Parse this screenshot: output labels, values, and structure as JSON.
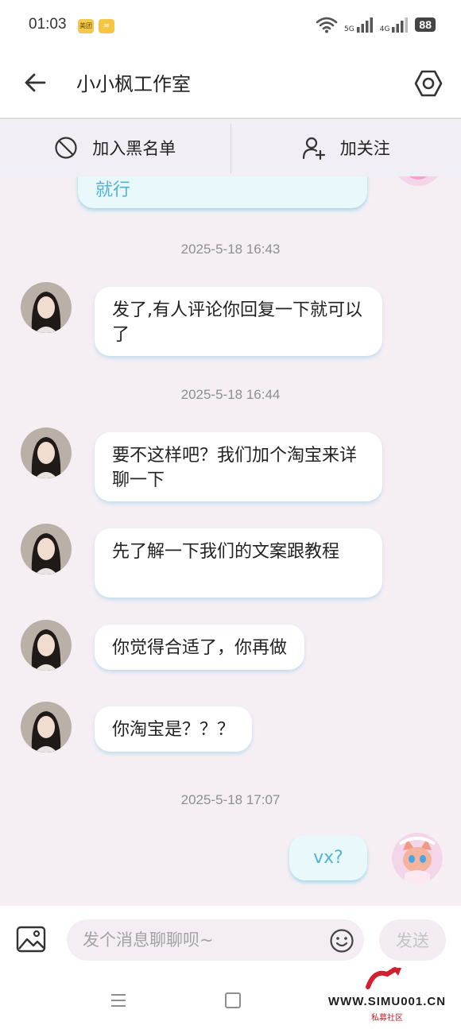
{
  "status_bar": {
    "time": "01:03",
    "app_badges": [
      "美团",
      "✉"
    ],
    "net_5g": "5G",
    "net_4g": "4G",
    "battery": "88"
  },
  "header": {
    "title": "小小枫工作室"
  },
  "actions": {
    "block_label": "加入黑名单",
    "follow_label": "加关注"
  },
  "messages": {
    "partial_mine": "就行",
    "t1": "2025-5-18 16:43",
    "m1": "发了,有人评论你回复一下就可以了",
    "t2": "2025-5-18 16:44",
    "m2": "要不这样吧？我们加个淘宝来详聊一下",
    "m3": "先了解一下我们的文案跟教程",
    "m4": "你觉得合适了，你再做",
    "m5": "你淘宝是？？？",
    "t3": "2025-5-18 17:07",
    "m6": "vx?"
  },
  "input": {
    "placeholder": "发个消息聊聊呗~",
    "send_label": "发送"
  },
  "watermark": {
    "site": "WWW.SIMU001.CN",
    "tagline": "私募社区"
  },
  "colors": {
    "accent": "#4fb5d2",
    "chat_bg": "#f5eff4",
    "watermark_red": "#d32030"
  }
}
